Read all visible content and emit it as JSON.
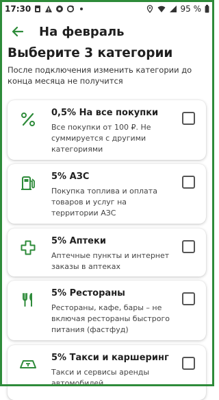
{
  "status_bar": {
    "time": "17:30",
    "battery_text": "95 %",
    "left_icons": [
      "sim-card-icon",
      "alert-icon",
      "messenger-icon",
      "sync-icon",
      "dot-icon"
    ],
    "right_icons": [
      "location-icon",
      "wifi-icon",
      "signal-icon",
      "battery-icon"
    ]
  },
  "app_bar": {
    "back_icon": "back-arrow-icon",
    "title": "На февраль"
  },
  "heading": "Выберите 3 категории",
  "subtext": "После подключения изменить категории до конца месяца не получится",
  "accent_color": "#2e8b3a",
  "categories": [
    {
      "icon": "percent-icon",
      "title": "0,5% На все покупки",
      "desc": "Все покупки от 100 ₽. Не суммируется с другими категориями",
      "checked": false
    },
    {
      "icon": "fuel-pump-icon",
      "title": "5% АЗС",
      "desc": "Покупка топлива и оплата товаров и услуг на территории АЗС",
      "checked": false
    },
    {
      "icon": "pharmacy-cross-icon",
      "title": "5% Аптеки",
      "desc": "Аптечные пункты и интернет заказы в аптеках",
      "checked": false
    },
    {
      "icon": "fork-knife-icon",
      "title": "5% Рестораны",
      "desc": "Рестораны, кафе, бары – не включая рестораны быстрого питания (фастфуд)",
      "checked": false
    },
    {
      "icon": "taxi-icon",
      "title": "5% Такси и каршеринг",
      "desc": "Такси и сервисы аренды автомобилей",
      "checked": false
    }
  ]
}
